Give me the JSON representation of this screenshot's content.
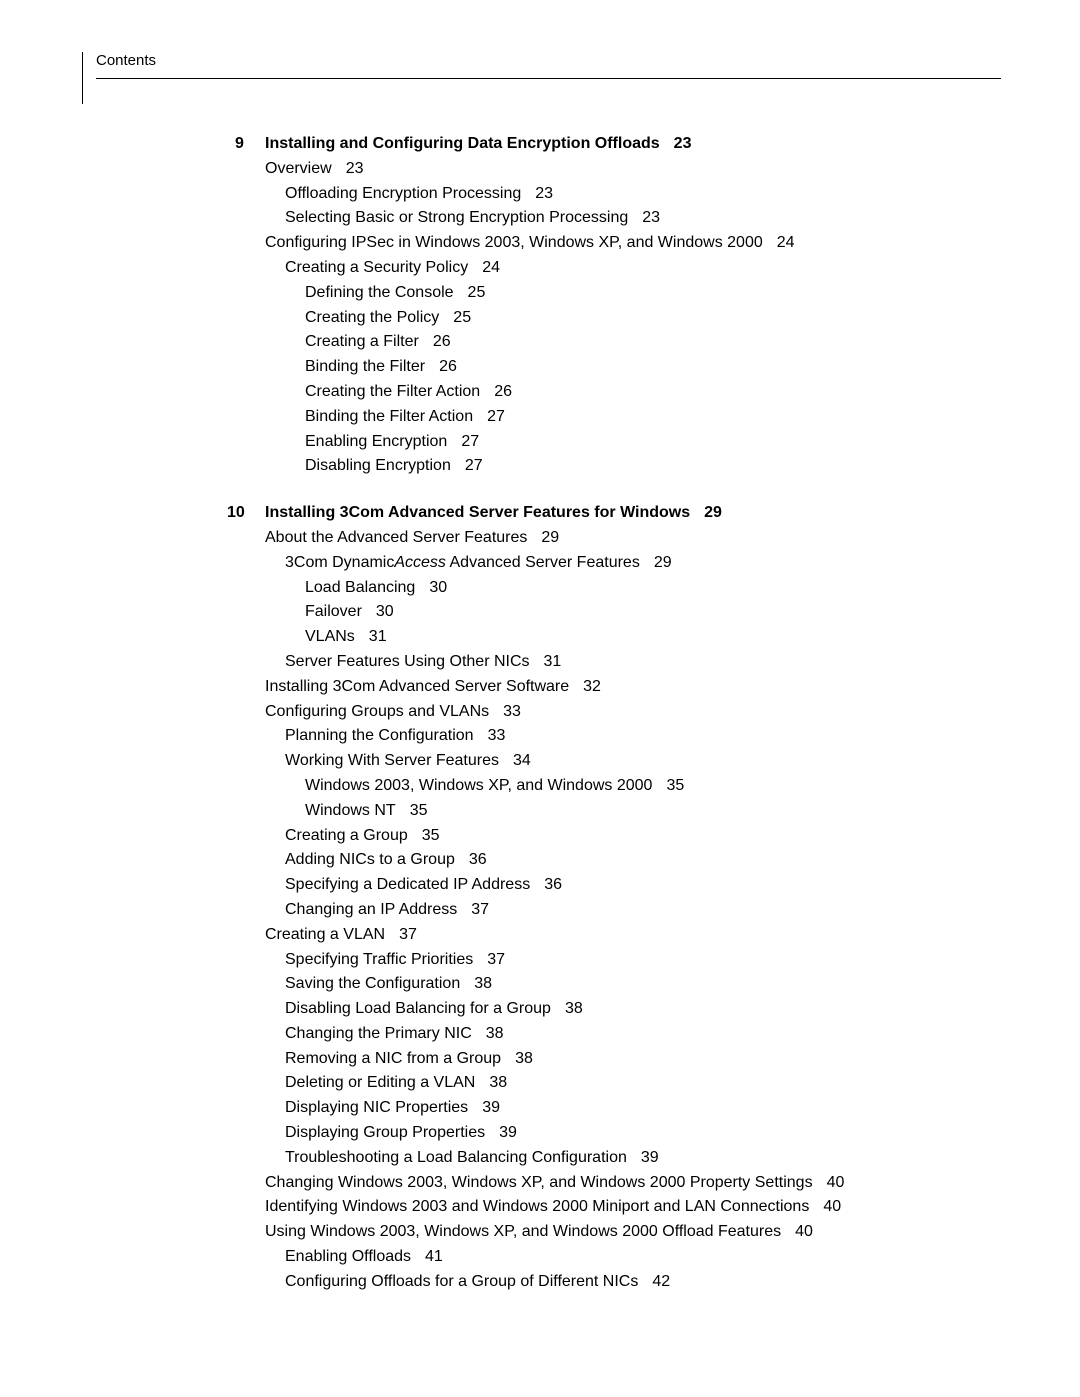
{
  "header": {
    "label": "Contents"
  },
  "chapters": [
    {
      "number": "9",
      "title": "Installing and Configuring Data Encryption Offloads",
      "page": "23",
      "entries": [
        {
          "level": 1,
          "text": "Overview",
          "page": "23"
        },
        {
          "level": 2,
          "text": "Offloading Encryption Processing",
          "page": "23"
        },
        {
          "level": 2,
          "text": "Selecting Basic or Strong Encryption Processing",
          "page": "23"
        },
        {
          "level": 1,
          "text": "Configuring IPSec in Windows 2003, Windows XP, and Windows 2000",
          "page": "24"
        },
        {
          "level": 2,
          "text": "Creating a Security Policy",
          "page": "24"
        },
        {
          "level": 3,
          "text": "Defining the Console",
          "page": "25"
        },
        {
          "level": 3,
          "text": "Creating the Policy",
          "page": "25"
        },
        {
          "level": 3,
          "text": "Creating a Filter",
          "page": "26"
        },
        {
          "level": 3,
          "text": "Binding the Filter",
          "page": "26"
        },
        {
          "level": 3,
          "text": "Creating the Filter Action",
          "page": "26"
        },
        {
          "level": 3,
          "text": "Binding the Filter Action",
          "page": "27"
        },
        {
          "level": 3,
          "text": "Enabling Encryption",
          "page": "27"
        },
        {
          "level": 3,
          "text": "Disabling Encryption",
          "page": "27"
        }
      ]
    },
    {
      "number": "10",
      "title": "Installing 3Com Advanced Server Features for Windows",
      "page": "29",
      "entries": [
        {
          "level": 1,
          "text": "About the Advanced Server Features",
          "page": "29"
        },
        {
          "level": 2,
          "html": "3Com Dynamic<span class=\"italic\">Access</span> Advanced Server Features",
          "page": "29"
        },
        {
          "level": 3,
          "text": "Load Balancing",
          "page": "30"
        },
        {
          "level": 3,
          "text": "Failover",
          "page": "30"
        },
        {
          "level": 3,
          "text": "VLANs",
          "page": "31"
        },
        {
          "level": 2,
          "text": "Server Features Using Other NICs",
          "page": "31"
        },
        {
          "level": 1,
          "text": "Installing 3Com Advanced Server Software",
          "page": "32"
        },
        {
          "level": 1,
          "text": "Configuring Groups and VLANs",
          "page": "33"
        },
        {
          "level": 2,
          "text": "Planning the Configuration",
          "page": "33"
        },
        {
          "level": 2,
          "text": "Working With Server Features",
          "page": "34"
        },
        {
          "level": 3,
          "text": "Windows 2003, Windows XP, and Windows 2000",
          "page": "35"
        },
        {
          "level": 3,
          "text": "Windows NT",
          "page": "35"
        },
        {
          "level": 2,
          "text": "Creating a Group",
          "page": "35"
        },
        {
          "level": 2,
          "text": "Adding NICs to a Group",
          "page": "36"
        },
        {
          "level": 2,
          "text": "Specifying a Dedicated IP Address",
          "page": "36"
        },
        {
          "level": 2,
          "text": "Changing an IP Address",
          "page": "37"
        },
        {
          "level": 1,
          "text": "Creating a VLAN",
          "page": "37"
        },
        {
          "level": 2,
          "text": "Specifying Traffic Priorities",
          "page": "37"
        },
        {
          "level": 2,
          "text": "Saving the Configuration",
          "page": "38"
        },
        {
          "level": 2,
          "text": "Disabling Load Balancing for a Group",
          "page": "38"
        },
        {
          "level": 2,
          "text": "Changing the Primary NIC",
          "page": "38"
        },
        {
          "level": 2,
          "text": "Removing a NIC from a Group",
          "page": "38"
        },
        {
          "level": 2,
          "text": "Deleting or Editing a VLAN",
          "page": "38"
        },
        {
          "level": 2,
          "text": "Displaying NIC Properties",
          "page": "39"
        },
        {
          "level": 2,
          "text": "Displaying Group Properties",
          "page": "39"
        },
        {
          "level": 2,
          "text": "Troubleshooting a Load Balancing Configuration",
          "page": "39"
        },
        {
          "level": 1,
          "text": "Changing Windows 2003, Windows XP, and Windows 2000 Property Settings",
          "page": "40"
        },
        {
          "level": 1,
          "text": "Identifying Windows 2003 and Windows 2000 Miniport and LAN Connections",
          "page": "40"
        },
        {
          "level": 1,
          "text": "Using Windows 2003, Windows XP, and Windows 2000 Offload Features",
          "page": "40"
        },
        {
          "level": 2,
          "text": "Enabling Offloads",
          "page": "41"
        },
        {
          "level": 2,
          "text": "Configuring Offloads for a Group of Different NICs",
          "page": "42"
        }
      ]
    }
  ]
}
